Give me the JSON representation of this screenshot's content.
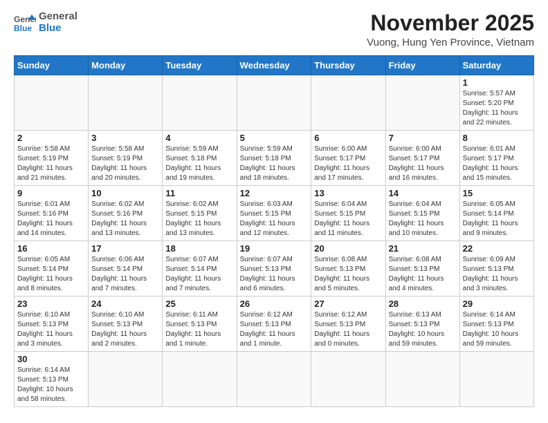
{
  "logo": {
    "line1": "General",
    "line2": "Blue"
  },
  "title": "November 2025",
  "subtitle": "Vuong, Hung Yen Province, Vietnam",
  "days_of_week": [
    "Sunday",
    "Monday",
    "Tuesday",
    "Wednesday",
    "Thursday",
    "Friday",
    "Saturday"
  ],
  "weeks": [
    [
      {
        "day": "",
        "info": ""
      },
      {
        "day": "",
        "info": ""
      },
      {
        "day": "",
        "info": ""
      },
      {
        "day": "",
        "info": ""
      },
      {
        "day": "",
        "info": ""
      },
      {
        "day": "",
        "info": ""
      },
      {
        "day": "1",
        "info": "Sunrise: 5:57 AM\nSunset: 5:20 PM\nDaylight: 11 hours and 22 minutes."
      }
    ],
    [
      {
        "day": "2",
        "info": "Sunrise: 5:58 AM\nSunset: 5:19 PM\nDaylight: 11 hours and 21 minutes."
      },
      {
        "day": "3",
        "info": "Sunrise: 5:58 AM\nSunset: 5:19 PM\nDaylight: 11 hours and 20 minutes."
      },
      {
        "day": "4",
        "info": "Sunrise: 5:59 AM\nSunset: 5:18 PM\nDaylight: 11 hours and 19 minutes."
      },
      {
        "day": "5",
        "info": "Sunrise: 5:59 AM\nSunset: 5:18 PM\nDaylight: 11 hours and 18 minutes."
      },
      {
        "day": "6",
        "info": "Sunrise: 6:00 AM\nSunset: 5:17 PM\nDaylight: 11 hours and 17 minutes."
      },
      {
        "day": "7",
        "info": "Sunrise: 6:00 AM\nSunset: 5:17 PM\nDaylight: 11 hours and 16 minutes."
      },
      {
        "day": "8",
        "info": "Sunrise: 6:01 AM\nSunset: 5:17 PM\nDaylight: 11 hours and 15 minutes."
      }
    ],
    [
      {
        "day": "9",
        "info": "Sunrise: 6:01 AM\nSunset: 5:16 PM\nDaylight: 11 hours and 14 minutes."
      },
      {
        "day": "10",
        "info": "Sunrise: 6:02 AM\nSunset: 5:16 PM\nDaylight: 11 hours and 13 minutes."
      },
      {
        "day": "11",
        "info": "Sunrise: 6:02 AM\nSunset: 5:15 PM\nDaylight: 11 hours and 13 minutes."
      },
      {
        "day": "12",
        "info": "Sunrise: 6:03 AM\nSunset: 5:15 PM\nDaylight: 11 hours and 12 minutes."
      },
      {
        "day": "13",
        "info": "Sunrise: 6:04 AM\nSunset: 5:15 PM\nDaylight: 11 hours and 11 minutes."
      },
      {
        "day": "14",
        "info": "Sunrise: 6:04 AM\nSunset: 5:15 PM\nDaylight: 11 hours and 10 minutes."
      },
      {
        "day": "15",
        "info": "Sunrise: 6:05 AM\nSunset: 5:14 PM\nDaylight: 11 hours and 9 minutes."
      }
    ],
    [
      {
        "day": "16",
        "info": "Sunrise: 6:05 AM\nSunset: 5:14 PM\nDaylight: 11 hours and 8 minutes."
      },
      {
        "day": "17",
        "info": "Sunrise: 6:06 AM\nSunset: 5:14 PM\nDaylight: 11 hours and 7 minutes."
      },
      {
        "day": "18",
        "info": "Sunrise: 6:07 AM\nSunset: 5:14 PM\nDaylight: 11 hours and 7 minutes."
      },
      {
        "day": "19",
        "info": "Sunrise: 6:07 AM\nSunset: 5:13 PM\nDaylight: 11 hours and 6 minutes."
      },
      {
        "day": "20",
        "info": "Sunrise: 6:08 AM\nSunset: 5:13 PM\nDaylight: 11 hours and 5 minutes."
      },
      {
        "day": "21",
        "info": "Sunrise: 6:08 AM\nSunset: 5:13 PM\nDaylight: 11 hours and 4 minutes."
      },
      {
        "day": "22",
        "info": "Sunrise: 6:09 AM\nSunset: 5:13 PM\nDaylight: 11 hours and 3 minutes."
      }
    ],
    [
      {
        "day": "23",
        "info": "Sunrise: 6:10 AM\nSunset: 5:13 PM\nDaylight: 11 hours and 3 minutes."
      },
      {
        "day": "24",
        "info": "Sunrise: 6:10 AM\nSunset: 5:13 PM\nDaylight: 11 hours and 2 minutes."
      },
      {
        "day": "25",
        "info": "Sunrise: 6:11 AM\nSunset: 5:13 PM\nDaylight: 11 hours and 1 minute."
      },
      {
        "day": "26",
        "info": "Sunrise: 6:12 AM\nSunset: 5:13 PM\nDaylight: 11 hours and 1 minute."
      },
      {
        "day": "27",
        "info": "Sunrise: 6:12 AM\nSunset: 5:13 PM\nDaylight: 11 hours and 0 minutes."
      },
      {
        "day": "28",
        "info": "Sunrise: 6:13 AM\nSunset: 5:13 PM\nDaylight: 10 hours and 59 minutes."
      },
      {
        "day": "29",
        "info": "Sunrise: 6:14 AM\nSunset: 5:13 PM\nDaylight: 10 hours and 59 minutes."
      }
    ],
    [
      {
        "day": "30",
        "info": "Sunrise: 6:14 AM\nSunset: 5:13 PM\nDaylight: 10 hours and 58 minutes."
      },
      {
        "day": "",
        "info": ""
      },
      {
        "day": "",
        "info": ""
      },
      {
        "day": "",
        "info": ""
      },
      {
        "day": "",
        "info": ""
      },
      {
        "day": "",
        "info": ""
      },
      {
        "day": "",
        "info": ""
      }
    ]
  ]
}
